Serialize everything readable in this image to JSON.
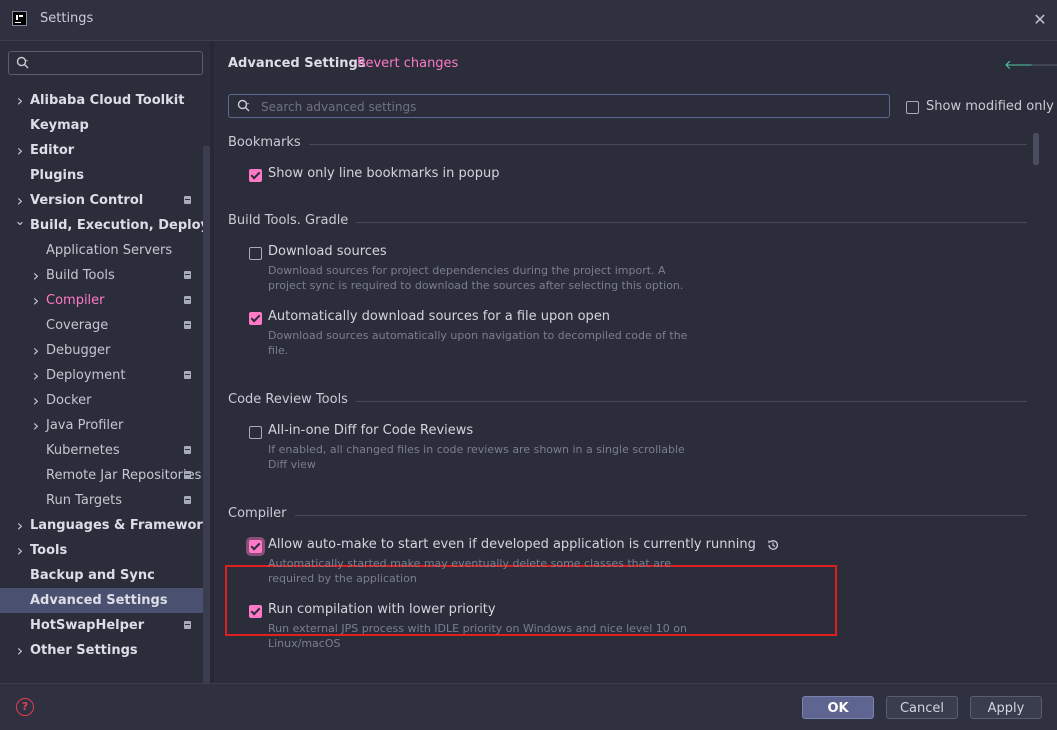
{
  "window": {
    "title": "Settings"
  },
  "sidebar": {
    "items": [
      {
        "label": "Alibaba Cloud Toolkit",
        "level": 0,
        "arrow": "collapsed",
        "badge": false
      },
      {
        "label": "Keymap",
        "level": 0,
        "arrow": "none",
        "badge": false
      },
      {
        "label": "Editor",
        "level": 0,
        "arrow": "collapsed",
        "badge": false
      },
      {
        "label": "Plugins",
        "level": 0,
        "arrow": "none",
        "badge": false
      },
      {
        "label": "Version Control",
        "level": 0,
        "arrow": "collapsed",
        "badge": true
      },
      {
        "label": "Build, Execution, Deployment",
        "level": 0,
        "arrow": "expanded",
        "badge": false
      },
      {
        "label": "Application Servers",
        "level": 1,
        "arrow": "none",
        "badge": false
      },
      {
        "label": "Build Tools",
        "level": 1,
        "arrow": "collapsed",
        "badge": true
      },
      {
        "label": "Compiler",
        "level": 1,
        "arrow": "collapsed",
        "badge": true,
        "highlight": true
      },
      {
        "label": "Coverage",
        "level": 1,
        "arrow": "none",
        "badge": true
      },
      {
        "label": "Debugger",
        "level": 1,
        "arrow": "collapsed",
        "badge": false
      },
      {
        "label": "Deployment",
        "level": 1,
        "arrow": "collapsed",
        "badge": true
      },
      {
        "label": "Docker",
        "level": 1,
        "arrow": "collapsed",
        "badge": false
      },
      {
        "label": "Java Profiler",
        "level": 1,
        "arrow": "collapsed",
        "badge": false
      },
      {
        "label": "Kubernetes",
        "level": 1,
        "arrow": "none",
        "badge": true
      },
      {
        "label": "Remote Jar Repositories",
        "level": 1,
        "arrow": "none",
        "badge": true
      },
      {
        "label": "Run Targets",
        "level": 1,
        "arrow": "none",
        "badge": true
      },
      {
        "label": "Languages & Frameworks",
        "level": 0,
        "arrow": "collapsed",
        "badge": false
      },
      {
        "label": "Tools",
        "level": 0,
        "arrow": "collapsed",
        "badge": false
      },
      {
        "label": "Backup and Sync",
        "level": 0,
        "arrow": "none",
        "badge": false
      },
      {
        "label": "Advanced Settings",
        "level": 0,
        "arrow": "none",
        "badge": false,
        "selected": true
      },
      {
        "label": "HotSwapHelper",
        "level": 0,
        "arrow": "none",
        "badge": true
      },
      {
        "label": "Other Settings",
        "level": 0,
        "arrow": "collapsed",
        "badge": false
      }
    ]
  },
  "main": {
    "title": "Advanced Settings",
    "revert_label": "Revert changes",
    "search_placeholder": "Search advanced settings",
    "show_modified_label": "Show modified only",
    "sections": [
      {
        "title": "Bookmarks",
        "options": [
          {
            "label": "Show only line bookmarks in popup",
            "checked": true,
            "desc": ""
          }
        ]
      },
      {
        "title": "Build Tools. Gradle",
        "options": [
          {
            "label": "Download sources",
            "checked": false,
            "desc": "Download sources for project dependencies during the project import. A project sync is required to download the sources after selecting this option."
          },
          {
            "label": "Automatically download sources for a file upon open",
            "checked": true,
            "desc": "Download sources automatically upon navigation to decompiled code of the file."
          }
        ]
      },
      {
        "title": "Code Review Tools",
        "options": [
          {
            "label": "All-in-one Diff for Code Reviews",
            "checked": false,
            "desc": "If enabled, all changed files in code reviews are shown in a single scrollable Diff view"
          }
        ]
      },
      {
        "title": "Compiler",
        "options": [
          {
            "label": "Allow auto-make to start even if developed application is currently running",
            "checked": true,
            "desc": "Automatically started make may eventually delete some classes that are required by the application"
          },
          {
            "label": "Run compilation with lower priority",
            "checked": true,
            "desc": "Run external JPS process with IDLE priority on Windows and nice level 10 on Linux/macOS"
          }
        ]
      }
    ]
  },
  "footer": {
    "help_label": "?",
    "ok_label": "OK",
    "cancel_label": "Cancel",
    "apply_label": "Apply"
  },
  "colors": {
    "accent": "#ff79c6",
    "selection": "#4a5170",
    "highlight_box": "#e02020"
  }
}
